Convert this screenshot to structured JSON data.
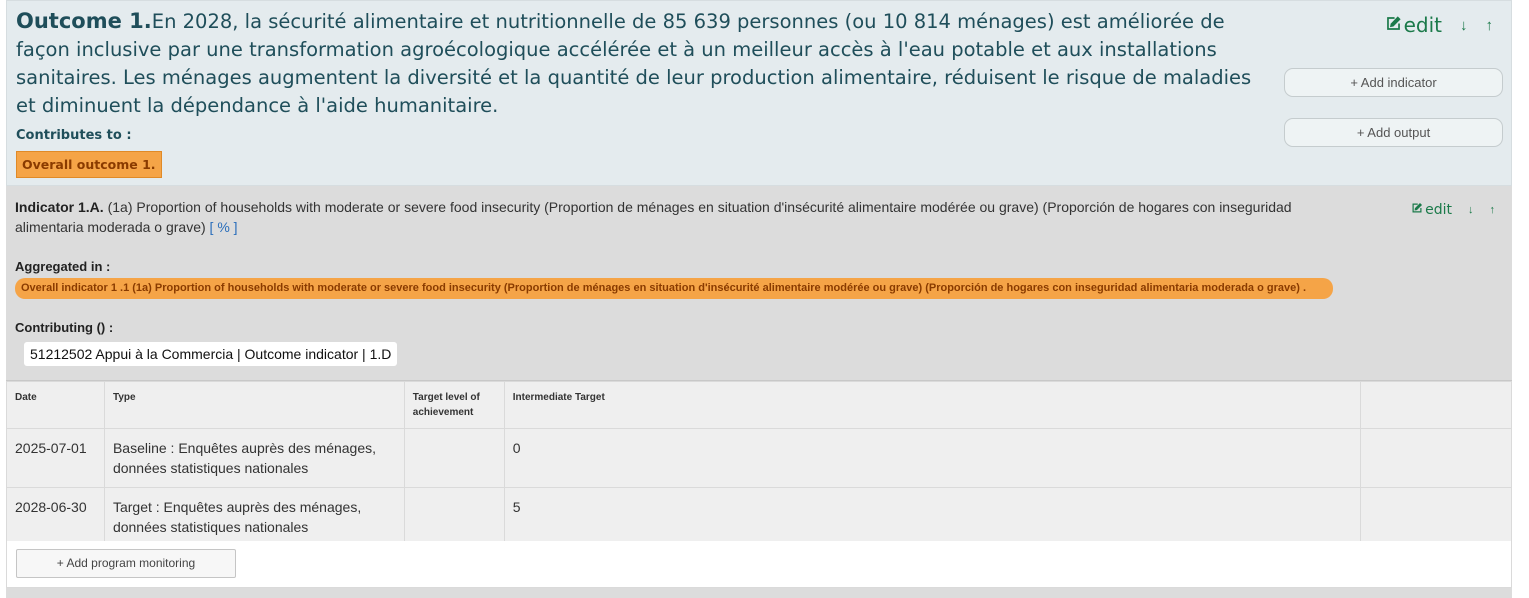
{
  "outcome": {
    "label": "Outcome 1.",
    "text": "En 2028, la sécurité alimentaire et nutritionnelle de 85 639 personnes (ou 10 814 ménages) est améliorée de façon inclusive par une transformation agroécologique accélérée et à un meilleur accès à l'eau potable et aux installations sanitaires. Les ménages augmentent la diversité et la quantité de leur production alimentaire, réduisent le risque de maladies et diminuent la dépendance à l'aide humanitaire.",
    "contributes_label": "Contributes to :",
    "contributes_tag": "Overall outcome 1.",
    "edit_label": "edit",
    "add_indicator_label": "+ Add indicator",
    "add_output_label": "+ Add output",
    "icons": [
      "edit-icon",
      "arrow-down-icon",
      "arrow-up-icon"
    ]
  },
  "indicator": {
    "label": "Indicator 1.A.",
    "text": "(1a) Proportion of households with moderate or severe food insecurity (Proportion de ménages en situation d'insécurité alimentaire modérée ou grave) (Proporción de hogares con inseguridad alimentaria moderada o grave)",
    "unit": "[ % ]",
    "edit_label": "edit",
    "aggregated_label": "Aggregated in :",
    "aggregated_tag": "Overall indicator 1 .1 (1a) Proportion of households with moderate or severe food insecurity (Proportion de ménages en situation d'insécurité alimentaire modérée ou grave) (Proporción de hogares con inseguridad alimentaria moderada o grave) .",
    "contributing_label": "Contributing () :",
    "contributing_item": "51212502 Appui à la Commercia | Outcome indicator | 1.D"
  },
  "table": {
    "headers": [
      "Date",
      "Type",
      "Target level of achievement",
      "Intermediate Target",
      ""
    ],
    "rows": [
      [
        "2025-07-01",
        "Baseline : Enquêtes auprès des ménages, données statistiques nationales",
        "",
        "0",
        ""
      ],
      [
        "2028-06-30",
        "Target : Enquêtes auprès des ménages, données statistiques nationales",
        "",
        "5",
        ""
      ]
    ]
  },
  "add_monitoring_label": "+ Add program monitoring",
  "colors": {
    "accent_green": "#1b7a4a",
    "outcome_text": "#1f4e5a",
    "orange_tag": "#f5a447",
    "outcome_bg": "#e4ebee",
    "indicator_bg": "#dcdcdc"
  }
}
